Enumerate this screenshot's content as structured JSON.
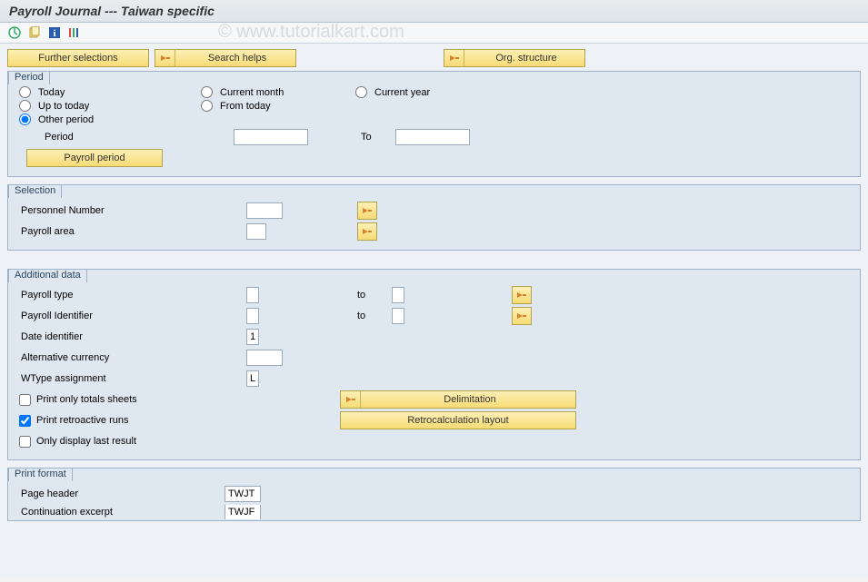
{
  "title": "Payroll Journal  --- Taiwan specific",
  "watermark": "© www.tutorialkart.com",
  "topButtons": {
    "further": "Further selections",
    "search": "Search helps",
    "org": "Org. structure"
  },
  "period": {
    "legend": "Period",
    "today": "Today",
    "currentMonth": "Current month",
    "currentYear": "Current year",
    "upToToday": "Up to today",
    "fromToday": "From today",
    "other": "Other period",
    "periodLabel": "Period",
    "toLabel": "To",
    "payrollPeriodBtn": "Payroll period",
    "periodValue": "",
    "toValue": ""
  },
  "selection": {
    "legend": "Selection",
    "personnel": "Personnel Number",
    "payrollArea": "Payroll area",
    "personnelValue": "",
    "payrollAreaValue": ""
  },
  "additional": {
    "legend": "Additional data",
    "payrollType": "Payroll type",
    "payrollIdentifier": "Payroll Identifier",
    "dateIdentifier": "Date identifier",
    "dateIdentifierValue": "1",
    "altCurrency": "Alternative currency",
    "wtype": "WType assignment",
    "wtypeValue": "L",
    "toLabel": "to",
    "printTotals": "Print only totals sheets",
    "printRetro": "Print retroactive runs",
    "onlyLast": "Only display last result",
    "delimBtn": "Delimitation",
    "retroBtn": "Retrocalculation layout",
    "payrollTypeValue": "",
    "payrollTypeTo": "",
    "payrollIdentifierValue": "",
    "payrollIdentifierTo": "",
    "altCurrencyValue": ""
  },
  "printFormat": {
    "legend": "Print format",
    "pageHeader": "Page header",
    "pageHeaderValue": "TWJT",
    "contExcerpt": "Continuation excerpt",
    "contExcerptValue": "TWJF"
  }
}
